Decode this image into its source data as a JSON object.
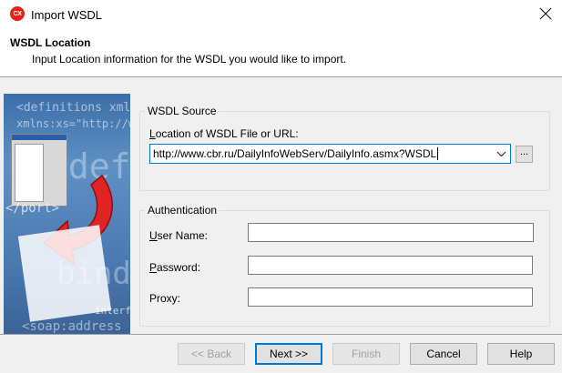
{
  "window": {
    "title": "Import WSDL",
    "app_icon_text": "CX",
    "accent": "#e2231a"
  },
  "header": {
    "title": "WSDL Location",
    "subtitle": "Input Location information for the WSDL you would like to import."
  },
  "side_image": {
    "code_lines": [
      "<definitions xmlns=\"htt",
      "xmlns:xs=\"http://www.w",
      "<defini",
      "</port>",
      "binding",
      "<soap:address"
    ],
    "caption": "interface"
  },
  "wsdl_source": {
    "legend": "WSDL Source",
    "location_label_prefix": "L",
    "location_label_rest": "ocation of WSDL File or URL:",
    "location_value": "http://www.cbr.ru/DailyInfoWebServ/DailyInfo.asmx?WSDL",
    "browse_label": "..."
  },
  "authentication": {
    "legend": "Authentication",
    "username_label_prefix": "U",
    "username_label_rest": "ser Name:",
    "password_label_prefix": "P",
    "password_label_rest": "assword:",
    "proxy_label": "Proxy:",
    "username_value": "",
    "password_value": "",
    "proxy_value": ""
  },
  "buttons": {
    "back": "<< Back",
    "next": "Next >>",
    "finish": "Finish",
    "cancel": "Cancel",
    "help": "Help"
  }
}
